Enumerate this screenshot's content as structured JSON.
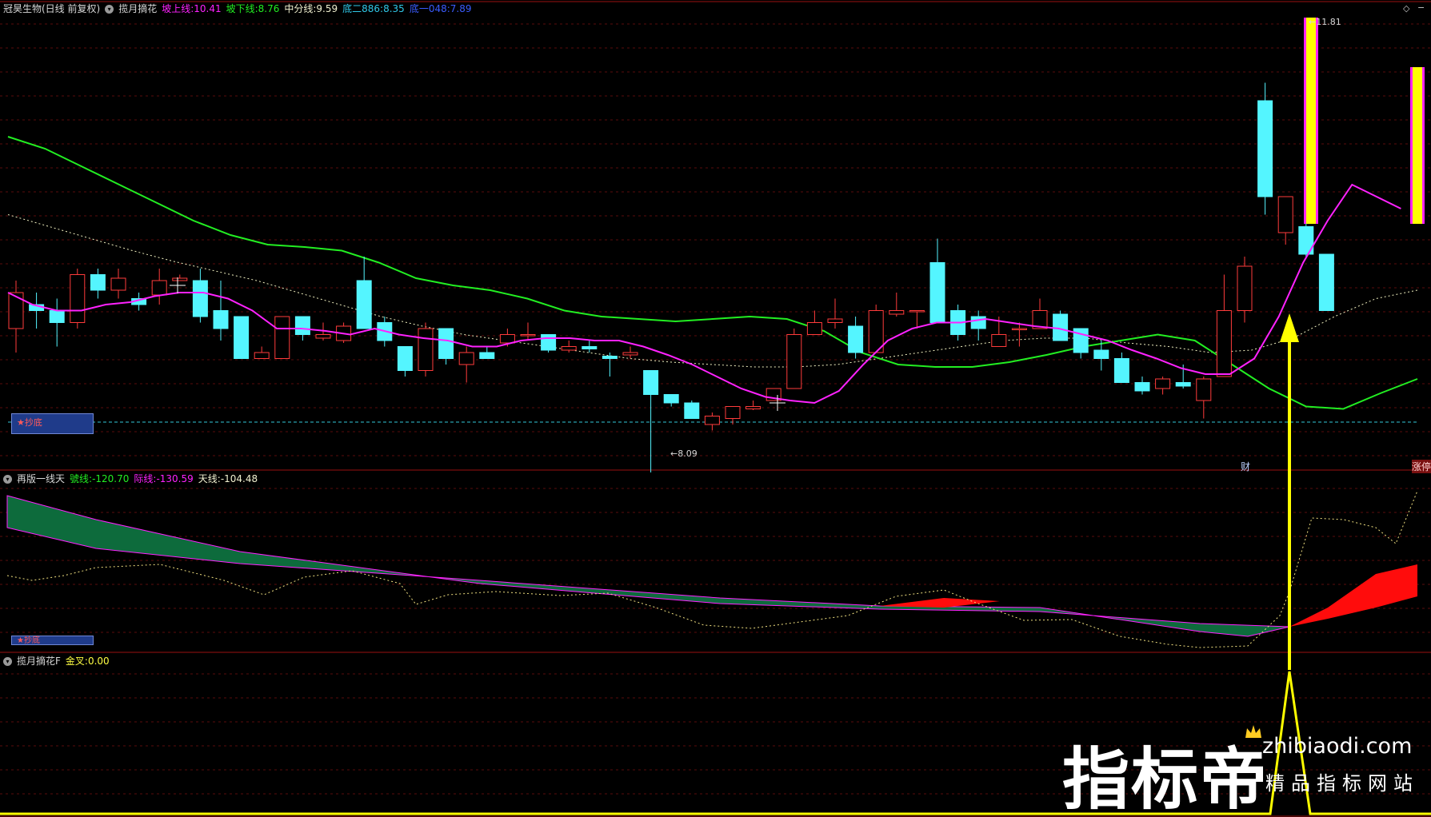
{
  "panel1": {
    "stock": "冠昊生物(日线 前复权)",
    "indicator": "揽月摘花",
    "upper_label": "坡上线:",
    "upper_value": "10.41",
    "lower_label": "坡下线:",
    "lower_value": "8.76",
    "mid_label": "中分线:",
    "mid_value": "9.59",
    "bottom2_label": "底二886:",
    "bottom2_value": "8.35",
    "bottom1_label": "底一048:",
    "bottom1_value": "7.89",
    "high_price": "11.81",
    "low_price": "8.09",
    "box_text": "★抄底",
    "marker_cai": "财",
    "marker_zt": "涨停"
  },
  "panel2": {
    "indicator": "再版一线天",
    "line1_label": "號线:",
    "line1_value": "-120.70",
    "line2_label": "际线:",
    "line2_value": "-130.59",
    "line3_label": "天线:",
    "line3_value": "-104.48",
    "box_text": "★抄底"
  },
  "panel3": {
    "indicator": "揽月摘花F",
    "gold_label": "金叉:",
    "gold_value": "0.00"
  },
  "controls": {
    "diamond": "◇",
    "minus": "−"
  },
  "watermark": {
    "cn": "指标帝",
    "url": "zhibiaodi.com",
    "sub": "精品指标网站"
  },
  "colors": {
    "up": "#ff3b3b",
    "down": "#54f5ff",
    "magenta": "#ff22ff",
    "green": "#22ee22",
    "yellow": "#ffff00",
    "divider": "#9a1010",
    "grid": "#5a0d0d",
    "dashed_cyan": "#32c8d8",
    "dark_green_band": "#0d6b3c",
    "red_band": "#ff0c0c"
  },
  "candles": [
    [
      9.3,
      9.6,
      9.7,
      9.1
    ],
    [
      9.5,
      9.45,
      9.6,
      9.3
    ],
    [
      9.45,
      9.35,
      9.55,
      9.15
    ],
    [
      9.35,
      9.75,
      9.8,
      9.3
    ],
    [
      9.75,
      9.62,
      9.8,
      9.55
    ],
    [
      9.62,
      9.72,
      9.8,
      9.55
    ],
    [
      9.55,
      9.5,
      9.6,
      9.45
    ],
    [
      9.58,
      9.7,
      9.8,
      9.5
    ],
    [
      9.7,
      9.72,
      9.75,
      9.7
    ],
    [
      9.7,
      9.4,
      9.8,
      9.35
    ],
    [
      9.45,
      9.3,
      9.7,
      9.2
    ],
    [
      9.4,
      9.05,
      9.4,
      9.05
    ],
    [
      9.05,
      9.1,
      9.15,
      9.05
    ],
    [
      9.05,
      9.4,
      9.4,
      9.05
    ],
    [
      9.4,
      9.25,
      9.4,
      9.2
    ],
    [
      9.22,
      9.25,
      9.35,
      9.2
    ],
    [
      9.2,
      9.32,
      9.35,
      9.18
    ],
    [
      9.7,
      9.3,
      9.9,
      9.3
    ],
    [
      9.35,
      9.2,
      9.4,
      9.15
    ],
    [
      9.15,
      8.95,
      9.15,
      8.9
    ],
    [
      8.95,
      9.3,
      9.35,
      8.9
    ],
    [
      9.3,
      9.05,
      9.3,
      9.0
    ],
    [
      9.0,
      9.1,
      9.15,
      8.85
    ],
    [
      9.1,
      9.05,
      9.15,
      9.05
    ],
    [
      9.18,
      9.25,
      9.3,
      9.15
    ],
    [
      9.25,
      9.25,
      9.35,
      9.2
    ],
    [
      9.25,
      9.12,
      9.25,
      9.1
    ],
    [
      9.12,
      9.15,
      9.2,
      9.1
    ],
    [
      9.15,
      9.13,
      9.2,
      9.1
    ],
    [
      9.07,
      9.05,
      9.1,
      8.9
    ],
    [
      9.08,
      9.1,
      9.15,
      9.05
    ],
    [
      8.95,
      8.75,
      8.95,
      8.1
    ],
    [
      8.75,
      8.68,
      8.75,
      8.65
    ],
    [
      8.68,
      8.55,
      8.7,
      8.55
    ],
    [
      8.5,
      8.57,
      8.6,
      8.45
    ],
    [
      8.55,
      8.65,
      8.65,
      8.5
    ],
    [
      8.63,
      8.65,
      8.7,
      8.62
    ],
    [
      8.7,
      8.8,
      8.8,
      8.7
    ],
    [
      8.8,
      9.25,
      9.3,
      8.8
    ],
    [
      9.25,
      9.35,
      9.45,
      9.25
    ],
    [
      9.35,
      9.38,
      9.55,
      9.3
    ],
    [
      9.32,
      9.1,
      9.4,
      9.05
    ],
    [
      9.1,
      9.45,
      9.5,
      9.1
    ],
    [
      9.42,
      9.45,
      9.6,
      9.4
    ],
    [
      9.45,
      9.45,
      9.45,
      9.3
    ],
    [
      9.85,
      9.35,
      10.05,
      9.35
    ],
    [
      9.45,
      9.25,
      9.5,
      9.2
    ],
    [
      9.4,
      9.3,
      9.45,
      9.2
    ],
    [
      9.15,
      9.25,
      9.4,
      9.15
    ],
    [
      9.3,
      9.3,
      9.35,
      9.15
    ],
    [
      9.3,
      9.45,
      9.55,
      9.3
    ],
    [
      9.42,
      9.2,
      9.45,
      9.2
    ],
    [
      9.3,
      9.1,
      9.3,
      9.05
    ],
    [
      9.12,
      9.05,
      9.2,
      8.95
    ],
    [
      9.05,
      8.85,
      9.1,
      8.85
    ],
    [
      8.85,
      8.78,
      8.9,
      8.75
    ],
    [
      8.8,
      8.88,
      8.9,
      8.75
    ],
    [
      8.85,
      8.82,
      9.0,
      8.8
    ],
    [
      8.7,
      8.88,
      8.9,
      8.55
    ],
    [
      8.9,
      9.45,
      9.75,
      8.9
    ],
    [
      9.45,
      9.82,
      9.9,
      9.35
    ],
    [
      11.2,
      10.4,
      11.35,
      10.25
    ],
    [
      10.1,
      10.4,
      10.4,
      10.0
    ],
    [
      10.15,
      9.92,
      10.25,
      9.9
    ],
    [
      9.92,
      9.45,
      9.92,
      9.45
    ]
  ],
  "ma_magenta": [
    9.6,
    9.5,
    9.45,
    9.45,
    9.5,
    9.52,
    9.57,
    9.6,
    9.6,
    9.55,
    9.45,
    9.3,
    9.3,
    9.28,
    9.25,
    9.3,
    9.25,
    9.22,
    9.2,
    9.15,
    9.15,
    9.2,
    9.22,
    9.22,
    9.2,
    9.2,
    9.15,
    9.08,
    9.0,
    8.9,
    8.8,
    8.73,
    8.7,
    8.68,
    8.78,
    9.0,
    9.2,
    9.3,
    9.35,
    9.35,
    9.38,
    9.35,
    9.32,
    9.3,
    9.25,
    9.2,
    9.12,
    9.05,
    8.97,
    8.92,
    8.92,
    9.05,
    9.4,
    9.85,
    10.2,
    10.5,
    10.4,
    10.3
  ],
  "ma_green": [
    10.9,
    10.8,
    10.65,
    10.5,
    10.35,
    10.2,
    10.08,
    10.0,
    9.98,
    9.95,
    9.85,
    9.72,
    9.66,
    9.62,
    9.55,
    9.45,
    9.4,
    9.38,
    9.36,
    9.38,
    9.4,
    9.38,
    9.28,
    9.1,
    9.0,
    8.98,
    8.98,
    9.02,
    9.08,
    9.15,
    9.2,
    9.25,
    9.2,
    9.0,
    8.8,
    8.65,
    8.63,
    8.76,
    8.88
  ],
  "ma_dashed": [
    10.25,
    10.15,
    10.05,
    9.95,
    9.86,
    9.78,
    9.7,
    9.6,
    9.5,
    9.4,
    9.32,
    9.25,
    9.2,
    9.15,
    9.1,
    9.05,
    9.02,
    9.0,
    8.98,
    8.98,
    9.0,
    9.05,
    9.1,
    9.15,
    9.2,
    9.22,
    9.22,
    9.18,
    9.15,
    9.1,
    9.12,
    9.22,
    9.4,
    9.55,
    9.62
  ]
}
